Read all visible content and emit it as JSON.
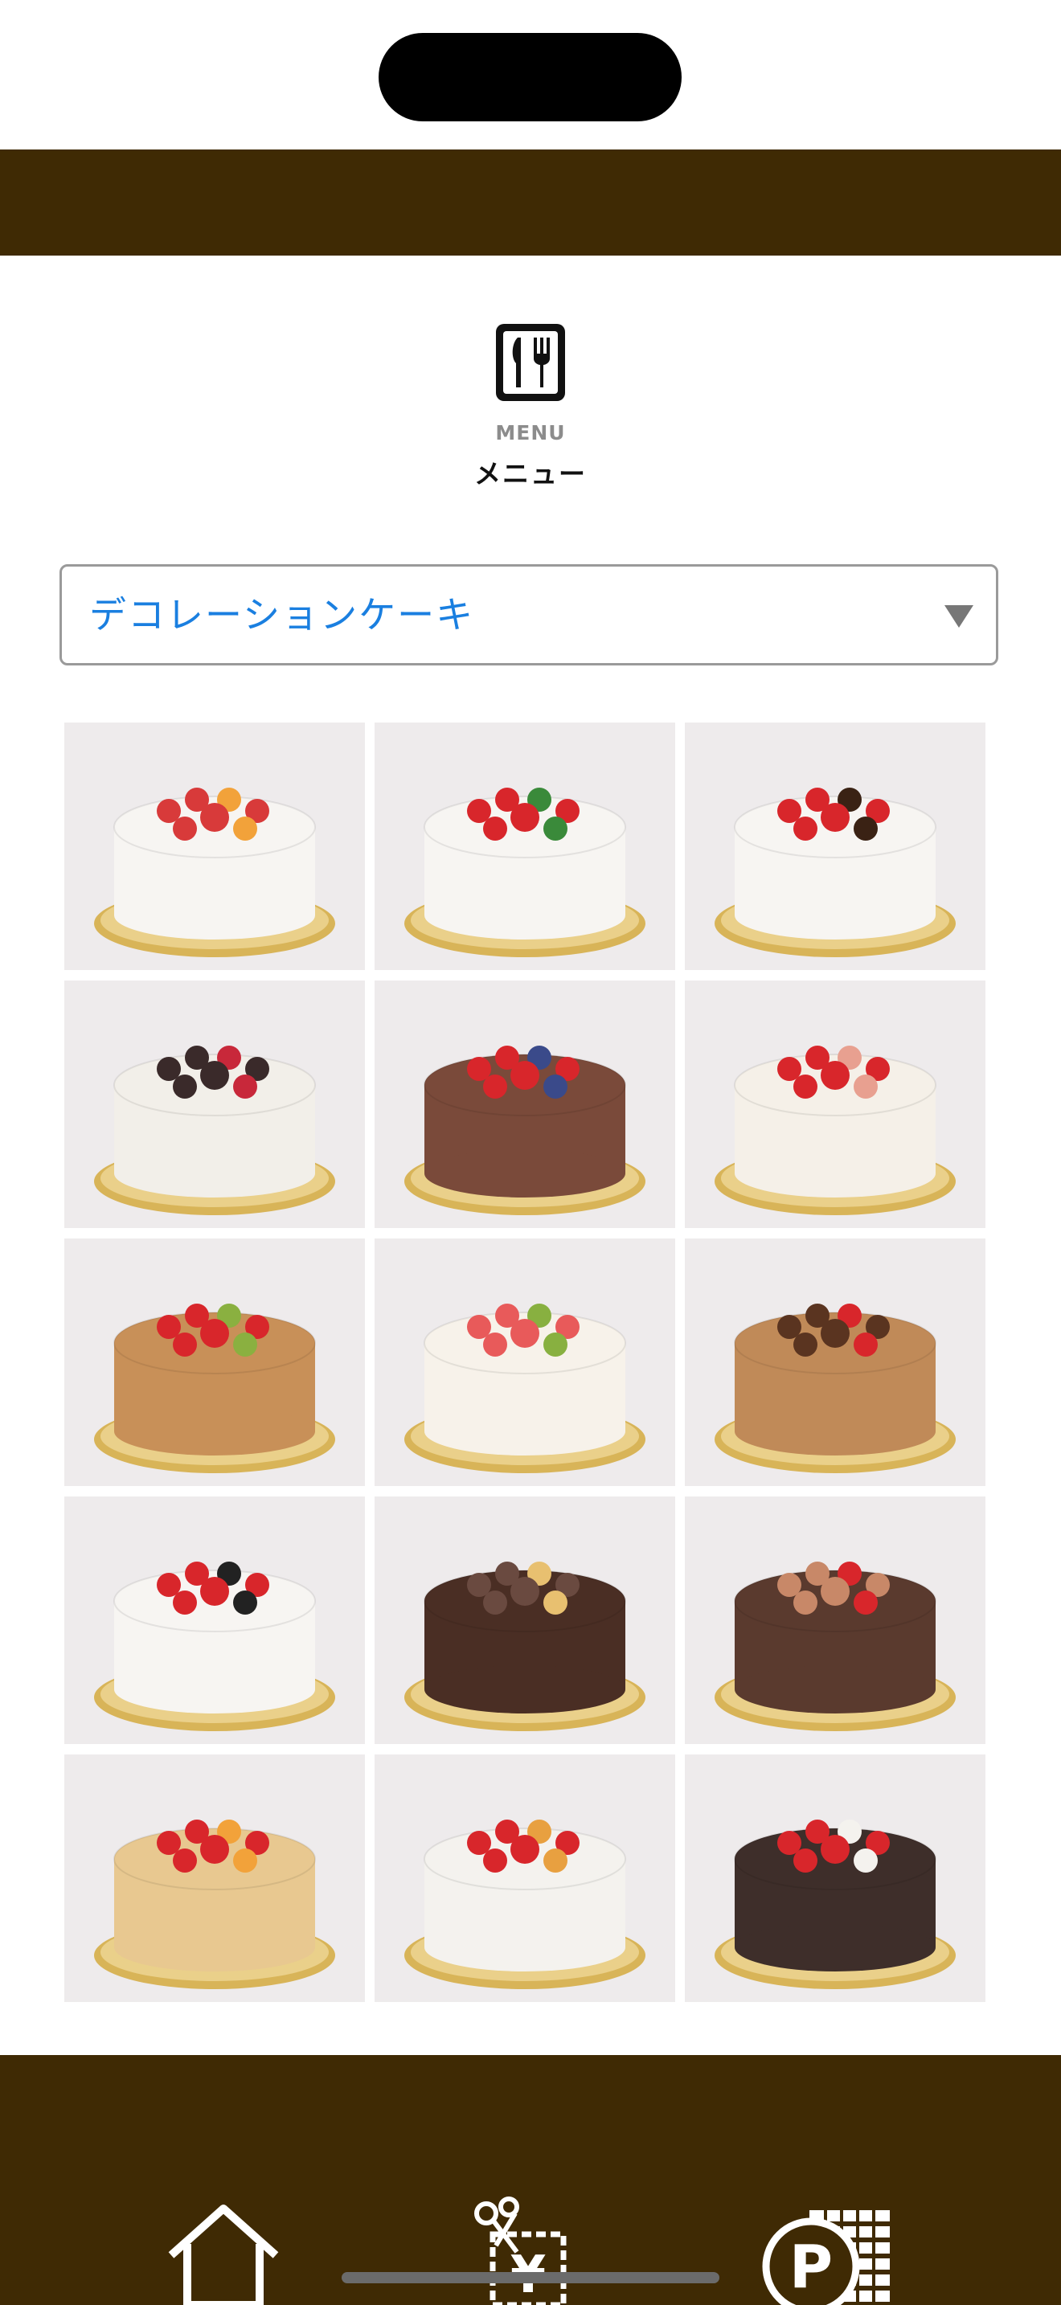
{
  "header": {
    "menu_label_en": "MENU",
    "menu_label_ja": "メニュー",
    "menu_icon": "fork-knife-icon"
  },
  "category_select": {
    "selected": "デコレーションケーキ",
    "arrow_icon": "dropdown-triangle-icon"
  },
  "colors": {
    "header_bar": "#3f2a04",
    "footer_bar": "#3f2a04",
    "select_text": "#1a7fe0"
  },
  "products": [
    {
      "name": "fruit-cake-photo"
    },
    {
      "name": "strawberry-shortcake-photo"
    },
    {
      "name": "chocolate-drip-strawberry-cake-photo"
    },
    {
      "name": "choux-tower-cake-photo"
    },
    {
      "name": "chocolate-strawberry-cake-photo"
    },
    {
      "name": "strawberry-cream-cake-photo"
    },
    {
      "name": "fruit-tart-photo"
    },
    {
      "name": "fruit-decoration-cake-photo"
    },
    {
      "name": "mont-blanc-cake-photo"
    },
    {
      "name": "piano-cake-photo"
    },
    {
      "name": "chocolate-castle-cake-photo"
    },
    {
      "name": "bear-cake-photo"
    },
    {
      "name": "fruit-cheesecake-photo"
    },
    {
      "name": "grape-cake-photo"
    },
    {
      "name": "car-cake-photo"
    }
  ],
  "footer": {
    "icons": [
      "home-icon",
      "coupon-yen-icon",
      "parking-icon"
    ]
  }
}
